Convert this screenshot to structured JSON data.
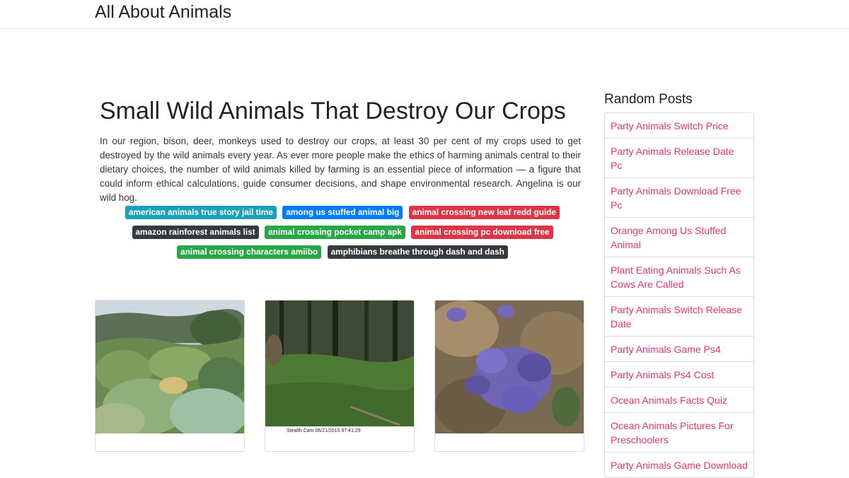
{
  "site": {
    "brand": "All About Animals"
  },
  "post": {
    "title": "Small Wild Animals That Destroy Our Crops",
    "body": "In our region, bison, deer, monkeys used to destroy our crops, at least 30 per cent of my crops used to get destroyed by the wild animals every year. As ever more people make the ethics of harming animals central to their dietary choices, the number of wild animals killed by farming is an essential piece of information — a figure that could inform ethical calculations, guide consumer decisions, and shape environmental research. Angelina is our wild hog."
  },
  "tags": [
    {
      "label": "american animals true story jail time",
      "color": "#17a2b8"
    },
    {
      "label": "among us stuffed animal big",
      "color": "#007bff"
    },
    {
      "label": "animal crossing new leaf redd guide",
      "color": "#dc3545"
    },
    {
      "label": "amazon rainforest animals list",
      "color": "#343a40"
    },
    {
      "label": "animal crossing pocket camp apk",
      "color": "#28a745"
    },
    {
      "label": "animal crossing pc download free",
      "color": "#dc3545"
    },
    {
      "label": "animal crossing characters amiibo",
      "color": "#28a745"
    },
    {
      "label": "amphibians breathe through dash and dash",
      "color": "#343a40"
    }
  ],
  "cards": [
    {
      "image": "garden-photo"
    },
    {
      "image": "deer-trailcam-photo",
      "caption": "Stealth Cam   06/21/2015   07:41:29"
    },
    {
      "image": "purple-flowers-photo"
    }
  ],
  "sidebar": {
    "title": "Random Posts",
    "items": [
      {
        "label": "Party Animals Switch Price"
      },
      {
        "label": "Party Animals Release Date Pc"
      },
      {
        "label": "Party Animals Download Free Pc"
      },
      {
        "label": "Orange Among Us Stuffed Animal"
      },
      {
        "label": "Plant Eating Animals Such As Cows Are Called"
      },
      {
        "label": "Party Animals Switch Release Date"
      },
      {
        "label": "Party Animals Game Ps4"
      },
      {
        "label": "Party Animals Ps4 Cost"
      },
      {
        "label": "Ocean Animals Facts Quiz"
      },
      {
        "label": "Ocean Animals Pictures For Preschoolers"
      },
      {
        "label": "Party Animals Game Download"
      }
    ],
    "link_color": "#e8336d"
  }
}
